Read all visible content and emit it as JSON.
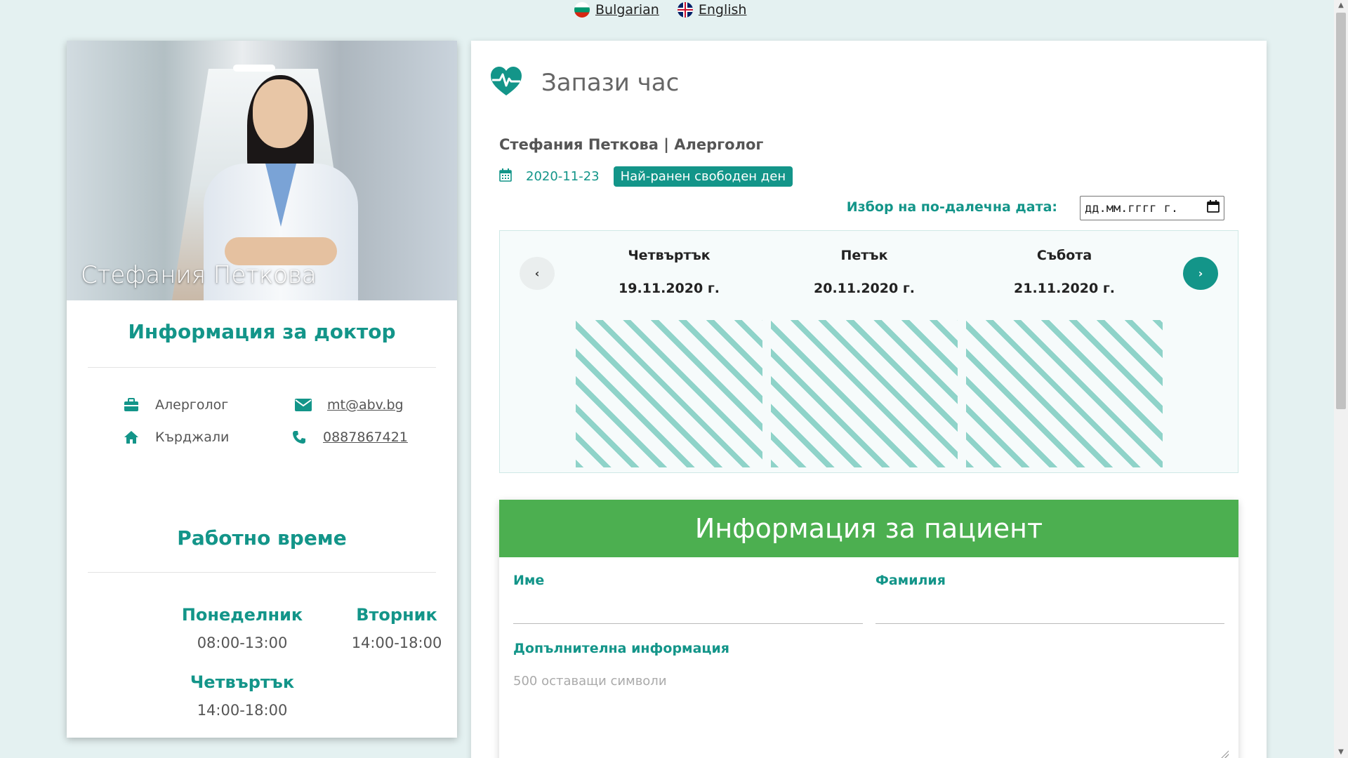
{
  "languages": [
    {
      "label": "Bulgarian"
    },
    {
      "label": "English"
    }
  ],
  "doctor": {
    "name": "Стефания Петкова",
    "info_title": "Информация за доктор",
    "specialty": "Алерголог",
    "email": "mt@abv.bg",
    "city": "Кърджали",
    "phone": "0887867421",
    "hours_title": "Работно време",
    "hours": [
      {
        "day": "Понеделник",
        "time": "08:00-13:00"
      },
      {
        "day": "Вторник",
        "time": "14:00-18:00"
      },
      {
        "day": "Четвъртък",
        "time": "14:00-18:00"
      }
    ]
  },
  "booking": {
    "title": "Запази час",
    "doctor_line": "Стефания Петкова | Алерголог",
    "earliest_date": "2020-11-23",
    "earliest_badge": "Най-ранен свободен ден",
    "pick_label": "Избор на по-далечна дата:",
    "date_placeholder": "дд.мм.гггг г.",
    "days": [
      {
        "name": "Четвъртък",
        "date": "19.11.2020 г."
      },
      {
        "name": "Петък",
        "date": "20.11.2020 г."
      },
      {
        "name": "Събота",
        "date": "21.11.2020 г."
      }
    ],
    "prev_icon": "‹",
    "next_icon": "›"
  },
  "patient": {
    "title": "Информация за пациент",
    "first_name_label": "Име",
    "last_name_label": "Фамилия",
    "extra_label": "Допълнителна информация",
    "extra_placeholder": "500 оставащи символи"
  },
  "colors": {
    "teal": "#139589",
    "green": "#4caf50"
  }
}
